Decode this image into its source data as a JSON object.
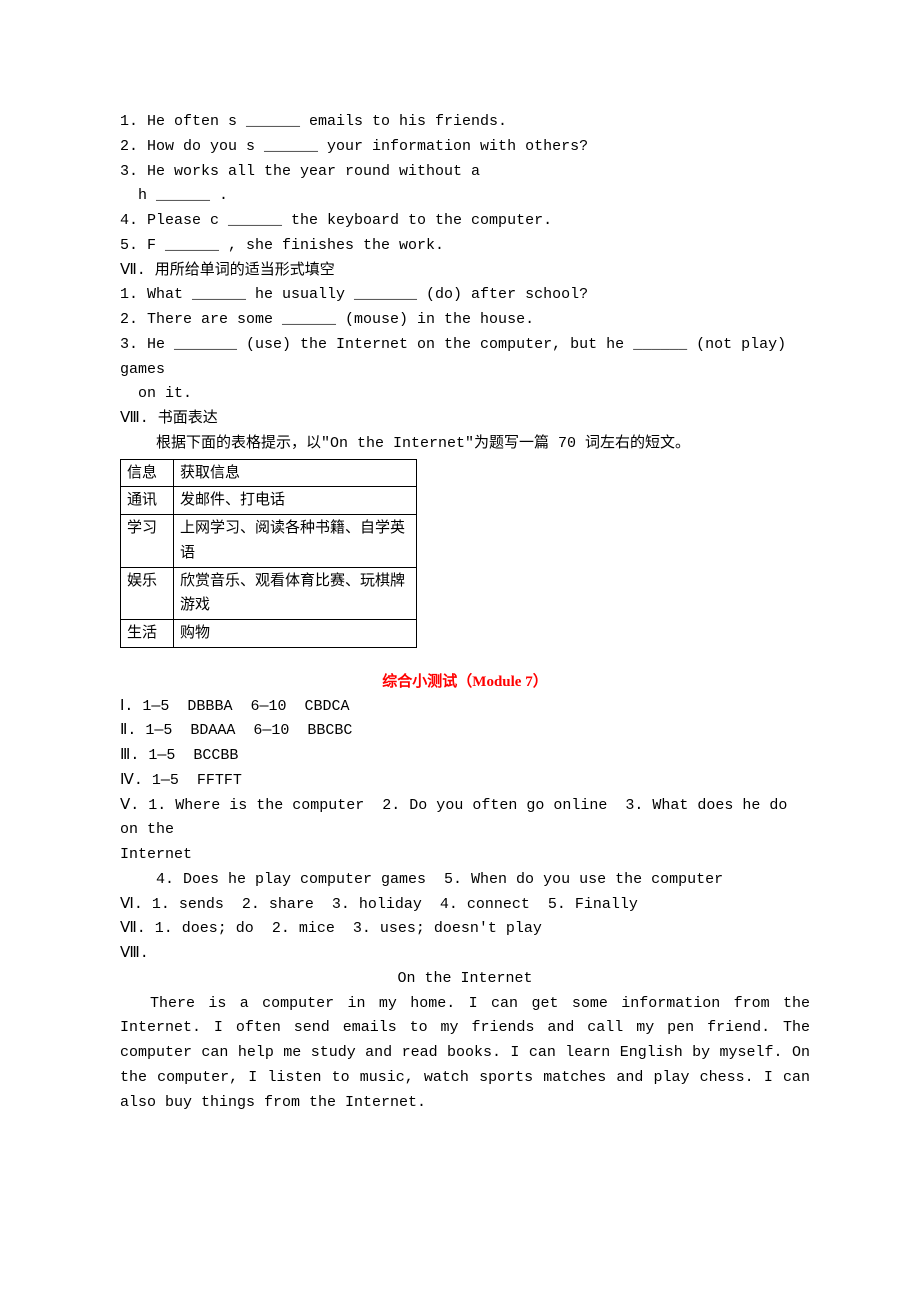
{
  "section6": {
    "q1": "1. He often s ______ emails to his friends.",
    "q2": "2. How do you s ______ your information with others?",
    "q3a": "3. He works all the year round without a",
    "q3b": "h ______ .",
    "q4": "4. Please c ______ the keyboard to the computer.",
    "q5": "5. F ______ , she finishes the work."
  },
  "section7": {
    "heading": "Ⅶ. 用所给单词的适当形式填空",
    "q1": "1. What ______ he usually _______ (do) after school?",
    "q2": "2. There are some ______ (mouse) in the house.",
    "q3a": "3. He _______ (use) the Internet on the computer, but he ______ (not play) games",
    "q3b": "on it."
  },
  "section8": {
    "heading": "Ⅷ. 书面表达",
    "intro": "根据下面的表格提示，以\"On the Internet\"为题写一篇 70 词左右的短文。",
    "rows": [
      [
        "信息",
        "获取信息"
      ],
      [
        "通讯",
        "发邮件、打电话"
      ],
      [
        "学习",
        "上网学习、阅读各种书籍、自学英语"
      ],
      [
        "娱乐",
        "欣赏音乐、观看体育比赛、玩棋牌游戏"
      ],
      [
        "生活",
        "购物"
      ]
    ]
  },
  "answers": {
    "title": "综合小测试（Module 7）",
    "I": "Ⅰ. 1—5  DBBBA  6—10  CBDCA",
    "II": "Ⅱ. 1—5  BDAAA  6—10  BBCBC",
    "III": "Ⅲ. 1—5  BCCBB",
    "IV": "Ⅳ. 1—5  FFTFT",
    "V1": "Ⅴ. 1. Where is the computer  2. Do you often go online  3. What does he do on the",
    "V2": "Internet",
    "V3": "4. Does he play computer games  5. When do you use the computer",
    "VI": "Ⅵ. 1. sends  2. share  3. holiday  4. connect  5. Finally",
    "VII": "Ⅶ. 1. does; do  2. mice  3. uses; doesn't play",
    "VIII": "Ⅷ.",
    "essayTitle": "On the Internet",
    "essayBody": "There is a computer in my home. I can get some information from the Internet. I often send emails to my friends and call my pen friend. The computer can help me study and read books. I can learn English by myself. On the computer, I listen to music, watch sports matches and play chess. I can also buy things from the Internet."
  }
}
